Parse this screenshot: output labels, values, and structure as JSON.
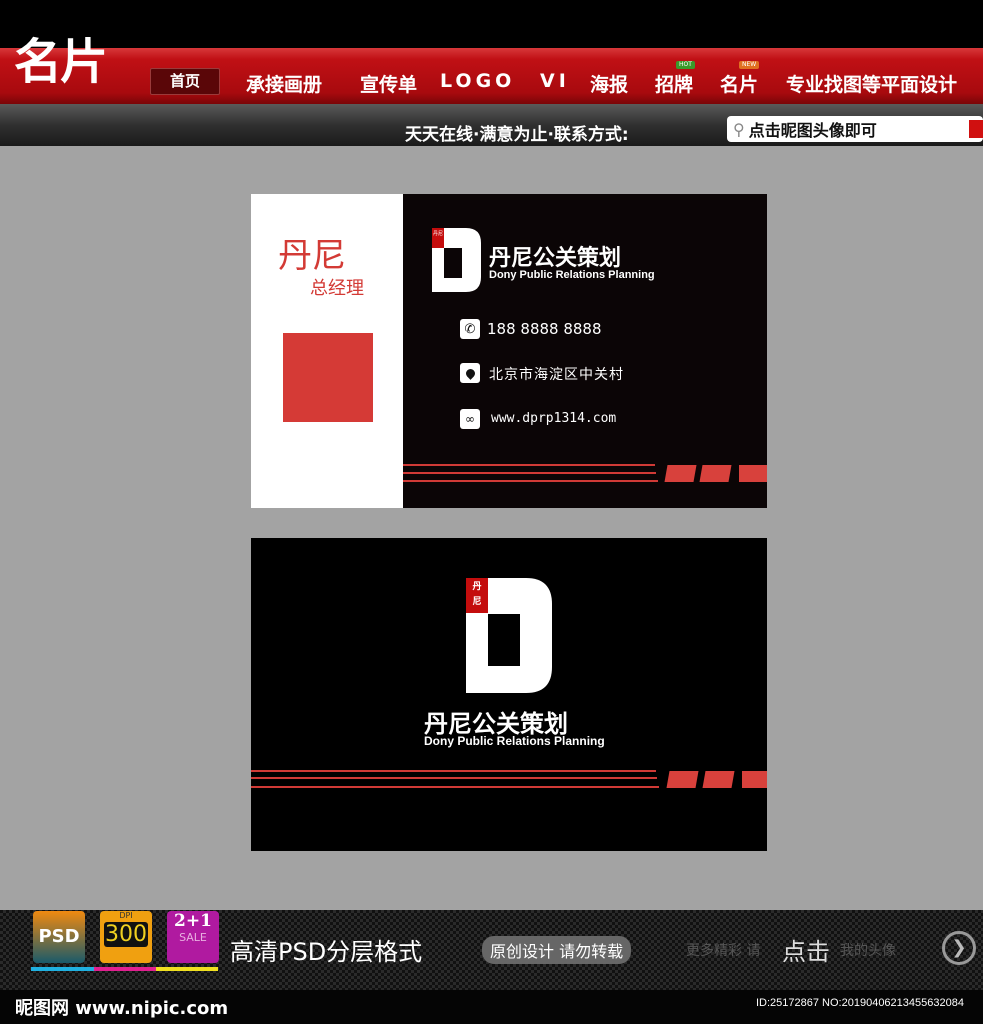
{
  "header": {
    "logo": "名片",
    "home": "首页",
    "nav": [
      "承接画册",
      "宣传单",
      "LOGO",
      "VI",
      "海报",
      "招牌",
      "名片",
      "专业找图等平面设计"
    ],
    "badges": {
      "hot": "HOT",
      "new": "NEW"
    },
    "slogan": "天天在线·满意为止·联系方式:",
    "search_text": "点击昵图头像即可"
  },
  "card_front": {
    "name": "丹尼",
    "title": "总经理",
    "seal": "丹尼",
    "company_cn": "丹尼公关策划",
    "company_en": "Dony Public Relations Planning",
    "phone": "188 8888 8888",
    "address": "北京市海淀区中关村",
    "website": "www.dprp1314.com"
  },
  "card_back": {
    "seal": "丹尼",
    "company_cn": "丹尼公关策划",
    "company_en": "Dony Public Relations Planning"
  },
  "footer": {
    "psd": "PSD",
    "dpi_label": "DPI",
    "dpi": "300",
    "sale_top": "2+1",
    "sale": "SALE",
    "headline": "高清PSD分层格式",
    "notice": "原创设计 请勿转载",
    "more": "更多精彩 请",
    "click": "点击",
    "avatar": "我的头像",
    "site": "昵图网 www.nipic.com",
    "id": "ID:25172867 NO:20190406213455632084"
  },
  "colors": {
    "red": "#d33a36",
    "bg": "#a3a3a3"
  }
}
